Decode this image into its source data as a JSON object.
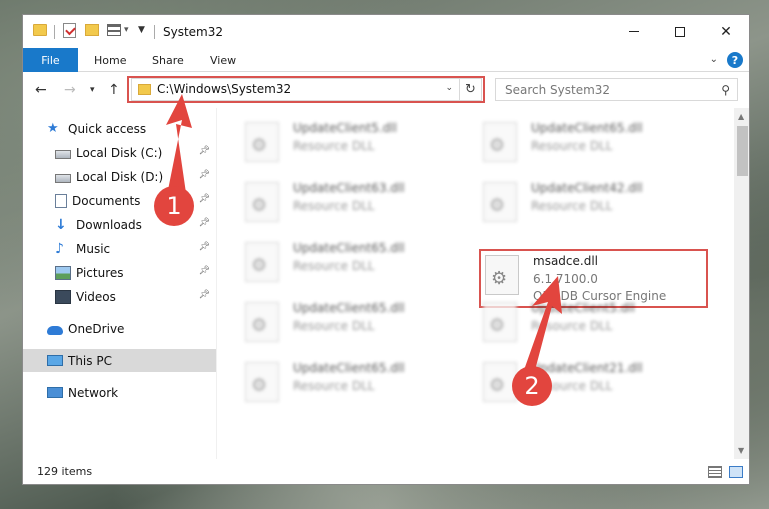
{
  "window": {
    "title": "System32",
    "controls": {
      "minimize": "",
      "maximize": "",
      "close": "✕"
    }
  },
  "ribbon": {
    "tabs": [
      "File",
      "Home",
      "Share",
      "View"
    ],
    "help": "?"
  },
  "nav": {
    "address": "C:\\Windows\\System32",
    "search_placeholder": "Search System32"
  },
  "sidebar": {
    "items": [
      {
        "label": "Quick access",
        "icon": "star-icon"
      },
      {
        "label": "Local Disk (C:)",
        "icon": "disk-icon",
        "pinned": true
      },
      {
        "label": "Local Disk (D:)",
        "icon": "disk-icon",
        "pinned": true
      },
      {
        "label": "Documents",
        "icon": "documents-icon",
        "pinned": true
      },
      {
        "label": "Downloads",
        "icon": "download-icon",
        "pinned": true
      },
      {
        "label": "Music",
        "icon": "music-icon",
        "pinned": true
      },
      {
        "label": "Pictures",
        "icon": "pictures-icon",
        "pinned": true
      },
      {
        "label": "Videos",
        "icon": "videos-icon",
        "pinned": true
      },
      {
        "label": "OneDrive",
        "icon": "cloud-icon"
      },
      {
        "label": "This PC",
        "icon": "pc-icon",
        "selected": true
      },
      {
        "label": "Network",
        "icon": "network-icon"
      }
    ]
  },
  "files": [
    {
      "name": "UpdateClient5.dll",
      "type": "Resource DLL",
      "blurred": true
    },
    {
      "name": "UpdateClient65.dll",
      "type": "Resource DLL",
      "blurred": true
    },
    {
      "name": "UpdateClient63.dll",
      "type": "Resource DLL",
      "blurred": true
    },
    {
      "name": "UpdateClient42.dll",
      "type": "Resource DLL",
      "blurred": true
    },
    {
      "name": "UpdateClient65.dll",
      "type": "Resource DLL",
      "blurred": true
    },
    {
      "name": "msadce.dll",
      "version": "6.1.7100.0",
      "description": "OLE DB Cursor Engine",
      "blurred": false
    },
    {
      "name": "UpdateClient65.dll",
      "type": "Resource DLL",
      "blurred": true
    },
    {
      "name": "UpdateClient5.dll",
      "type": "Resource DLL",
      "blurred": true
    },
    {
      "name": "UpdateClient65.dll",
      "type": "Resource DLL",
      "blurred": true
    },
    {
      "name": "UpdateClient21.dll",
      "type": "Resource DLL",
      "blurred": true
    }
  ],
  "status": {
    "item_count": "129 items"
  },
  "annotations": {
    "step1": "1",
    "step2": "2",
    "color": "#e2453e"
  }
}
